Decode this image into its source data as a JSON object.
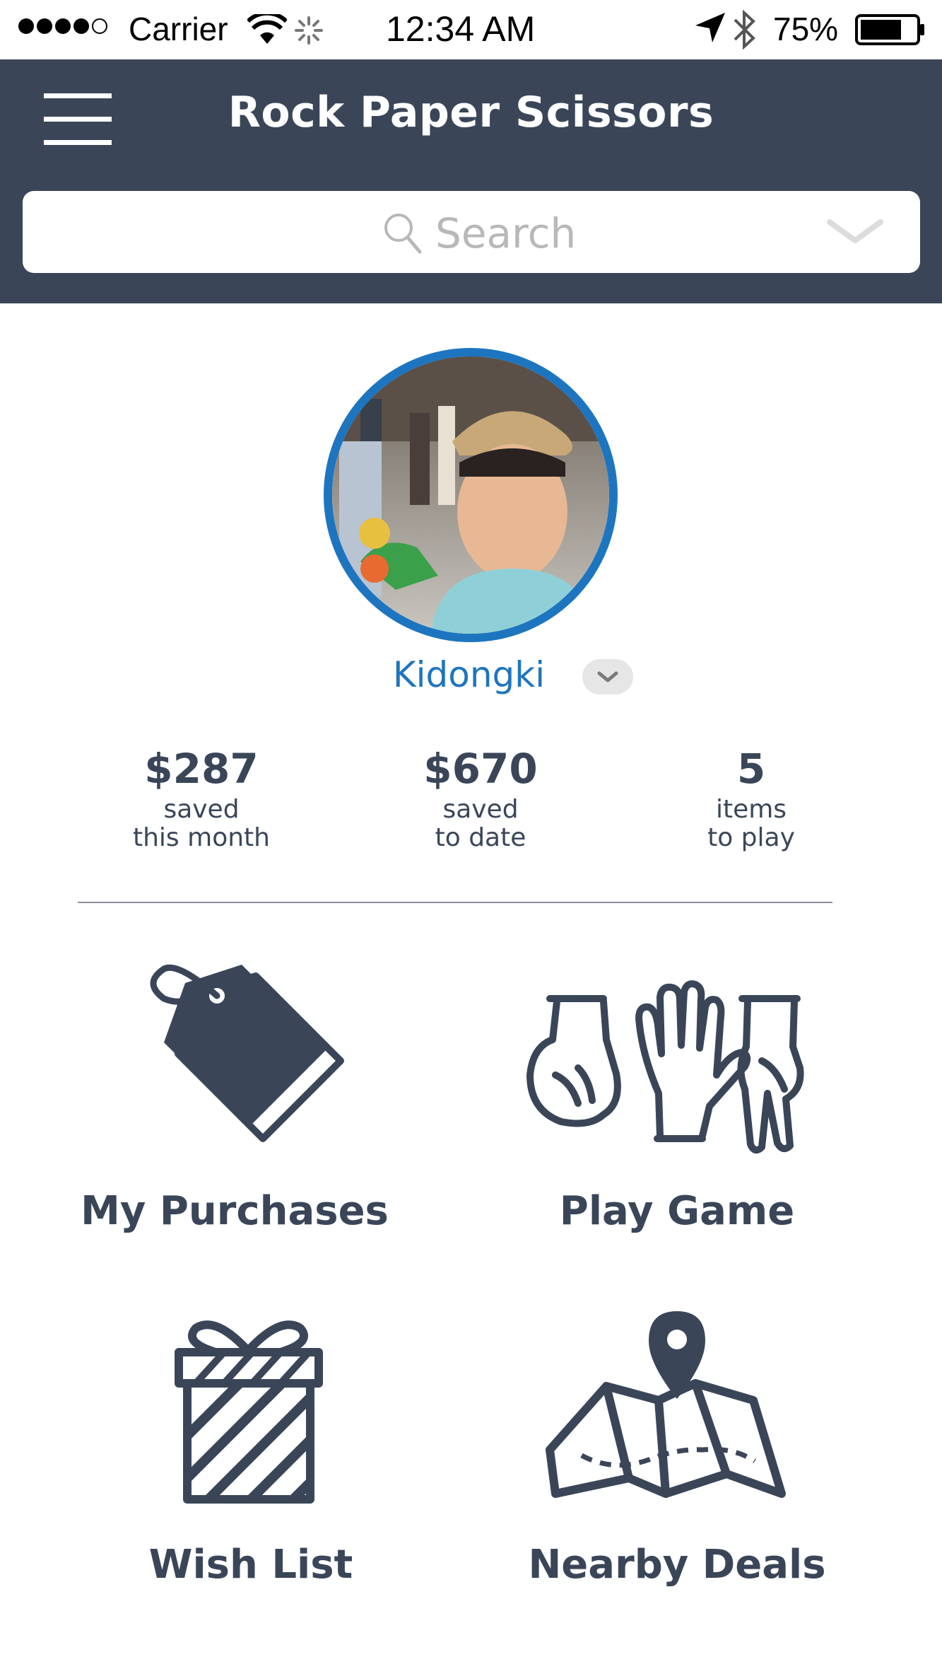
{
  "status_bar": {
    "carrier": "Carrier",
    "time": "12:34 AM",
    "battery_percent": "75%",
    "signal_bars_filled": 4,
    "signal_bars_total": 5,
    "battery_level": 0.75
  },
  "header": {
    "title": "Rock Paper Scissors",
    "background_color": "#3a4658"
  },
  "search": {
    "placeholder": "Search"
  },
  "profile": {
    "username": "Kidongki",
    "accent_color": "#1e75bf"
  },
  "stats": [
    {
      "value": "$287",
      "label_line1": "saved",
      "label_line2": "this month"
    },
    {
      "value": "$670",
      "label_line1": "saved",
      "label_line2": "to date"
    },
    {
      "value": "5",
      "label_line1": "items",
      "label_line2": "to play"
    }
  ],
  "menu": [
    {
      "label": "My Purchases",
      "icon": "price-tag-icon"
    },
    {
      "label": "Play Game",
      "icon": "rock-paper-scissors-hands-icon"
    },
    {
      "label": "Wish List",
      "icon": "gift-box-icon"
    },
    {
      "label": "Nearby Deals",
      "icon": "map-pin-icon"
    }
  ]
}
